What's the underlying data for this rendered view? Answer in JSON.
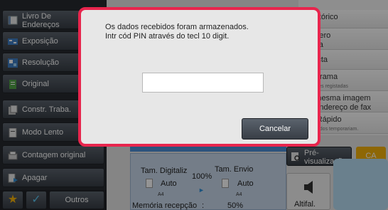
{
  "left_nav": {
    "items": [
      {
        "label": "Livro De\nEndereços",
        "icon": "address-book-icon"
      },
      {
        "label": "Exposição",
        "icon": "exposure-icon"
      },
      {
        "label": "Resolução",
        "icon": "resolution-icon"
      },
      {
        "label": "Original",
        "icon": "original-icon"
      },
      {
        "label": "Constr. Traba.",
        "icon": "job-build-icon"
      },
      {
        "label": "Modo Lento",
        "icon": "slow-mode-icon"
      },
      {
        "label": "Contagem original",
        "icon": "original-count-icon"
      },
      {
        "label": "Apagar",
        "icon": "erase-icon"
      }
    ],
    "others_label": "Outros"
  },
  "right_panel": {
    "items": [
      {
        "label": "r histórico",
        "sub": ""
      },
      {
        "label": "número\nscura",
        "sub": ""
      },
      {
        "label": "directa",
        "sub": ""
      },
      {
        "label": "programa",
        "sub": "efinições registadas"
      },
      {
        "label": "iar mesma imagem\nno endereço de fax",
        "sub": ""
      },
      {
        "label": "ch. Rápido",
        "sub": "ard. dados temporariam."
      }
    ]
  },
  "settings": {
    "scan_size_label": "Tam. Digitaliz",
    "scan_size_value": "Auto",
    "scan_paper": "A4",
    "ratio": "100%",
    "send_size_label": "Tam. Envio",
    "send_size_value": "Auto",
    "send_paper": "A4",
    "memory_label": "Memória recepção",
    "memory_sep": ":",
    "memory_value": "50%"
  },
  "bottom_actions": {
    "preview_label": "Pré-\nvisualização",
    "ca_label": "CA",
    "speaker_label": "Altifal."
  },
  "dialog": {
    "message_line1": "Os dados recebidos foram armazenados.",
    "message_line2": "Intr cód PIN através do tecl 10 digit.",
    "pin_value": "",
    "cancel_label": "Cancelar"
  },
  "colors": {
    "dialog_border": "#e8254d",
    "ca_button": "#f5b10a",
    "accent_blue": "#4d90d8"
  }
}
